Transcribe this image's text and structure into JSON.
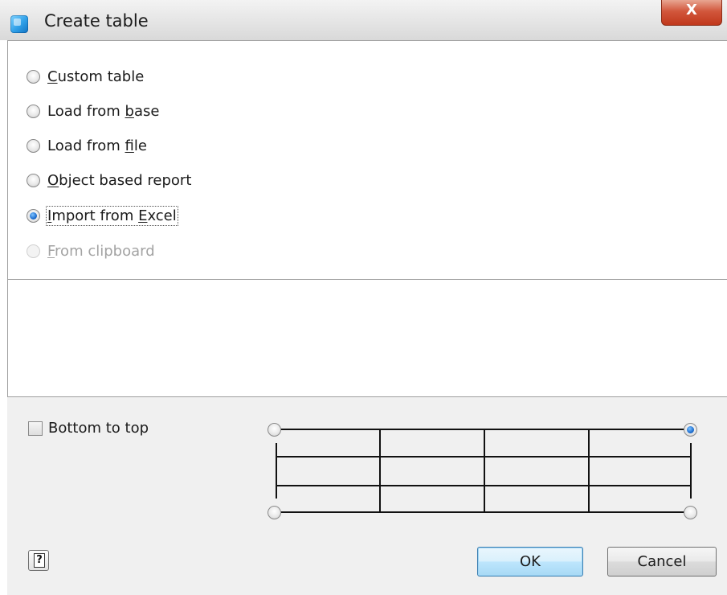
{
  "window": {
    "title": "Create table",
    "close_label": "X"
  },
  "source_options": [
    {
      "before": "",
      "key": "C",
      "after": "ustom table",
      "checked": false,
      "disabled": false
    },
    {
      "before": "Load from ",
      "key": "b",
      "after": "ase",
      "checked": false,
      "disabled": false
    },
    {
      "before": "Load from ",
      "key": "f",
      "after": "ile",
      "checked": false,
      "disabled": false
    },
    {
      "before": "",
      "key": "O",
      "after": "bject based report",
      "checked": false,
      "disabled": false
    },
    {
      "before": "",
      "key": "I",
      "after": "mport from ",
      "key2": "E",
      "after2": "xcel",
      "checked": true,
      "disabled": false
    },
    {
      "before": "",
      "key": "F",
      "after": "rom clipboard",
      "checked": false,
      "disabled": true
    }
  ],
  "direction": {
    "bottom_to_top_label": "Bottom to top",
    "bottom_to_top_checked": false
  },
  "start_corner": {
    "selected": "top-right"
  },
  "buttons": {
    "help_glyph": "?",
    "ok_label": "OK",
    "cancel_label": "Cancel"
  },
  "colors": {
    "accent": "#1f6fd0",
    "close_red": "#c0381c"
  }
}
